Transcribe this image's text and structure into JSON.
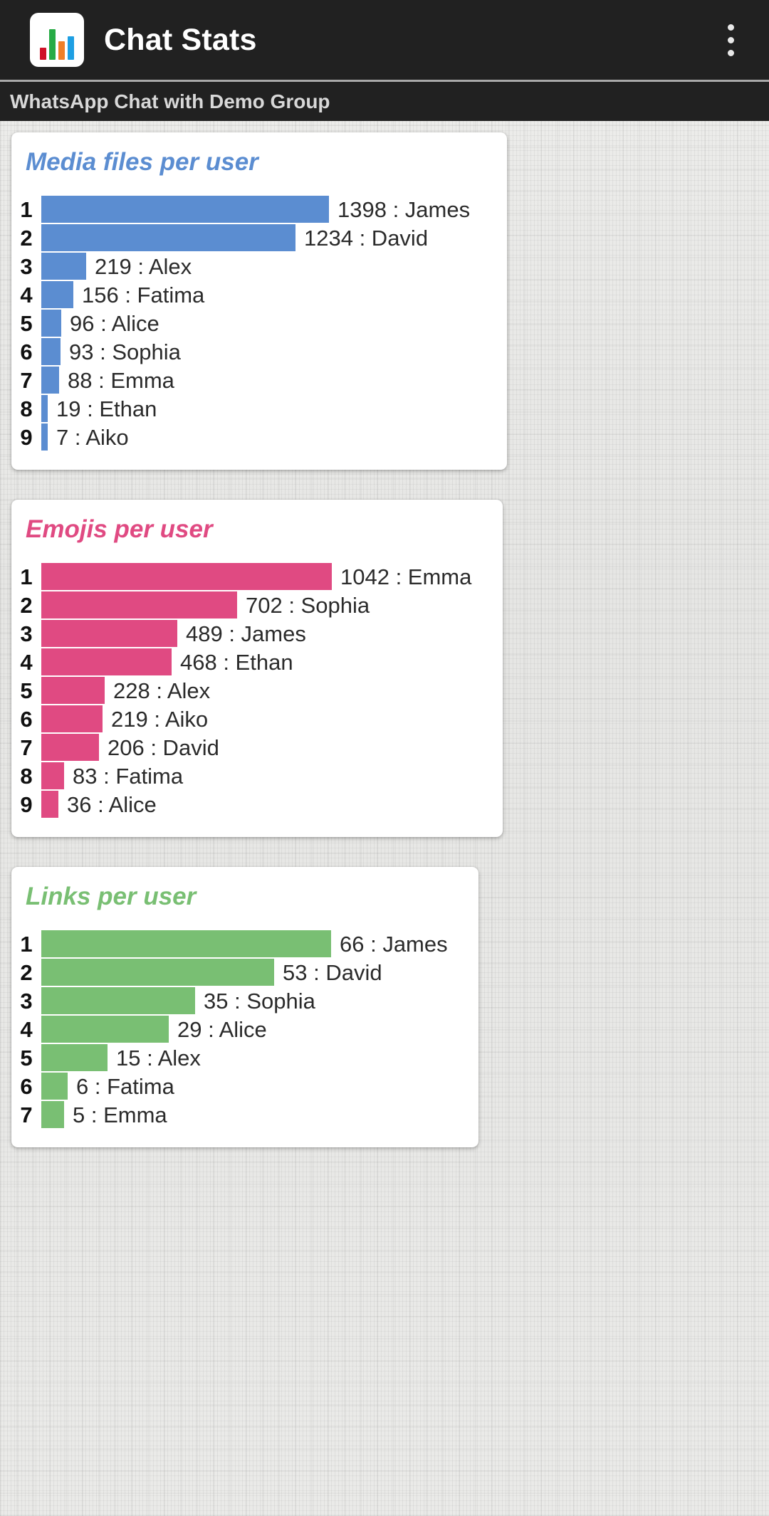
{
  "app": {
    "title": "Chat Stats",
    "icon_name": "bar-chart-app-icon",
    "icon_bar_colors": [
      "#cf1127",
      "#27ab45",
      "#f07f28",
      "#1e9fe3"
    ],
    "overflow_menu_label": "More options",
    "app_bar_color": "#212121",
    "subtitle": "WhatsApp Chat with Demo Group"
  },
  "chart_data": [
    {
      "type": "bar",
      "title": "Media files per user",
      "color": "#5b8dd1",
      "orientation": "horizontal",
      "xlabel": "",
      "ylabel": "",
      "max_value": 1398,
      "rows": [
        {
          "rank": "1",
          "value": 1398,
          "name": "James",
          "label": "1398 : James"
        },
        {
          "rank": "2",
          "value": 1234,
          "name": "David",
          "label": "1234 : David"
        },
        {
          "rank": "3",
          "value": 219,
          "name": "Alex",
          "label": "219 : Alex"
        },
        {
          "rank": "4",
          "value": 156,
          "name": "Fatima",
          "label": "156 : Fatima"
        },
        {
          "rank": "5",
          "value": 96,
          "name": "Alice",
          "label": "96 : Alice"
        },
        {
          "rank": "6",
          "value": 93,
          "name": "Sophia",
          "label": "93 : Sophia"
        },
        {
          "rank": "7",
          "value": 88,
          "name": "Emma",
          "label": "88 : Emma"
        },
        {
          "rank": "8",
          "value": 19,
          "name": "Ethan",
          "label": "19 : Ethan"
        },
        {
          "rank": "9",
          "value": 7,
          "name": "Aiko",
          "label": "7 : Aiko"
        }
      ]
    },
    {
      "type": "bar",
      "title": "Emojis per user",
      "color": "#e04a82",
      "orientation": "horizontal",
      "xlabel": "",
      "ylabel": "",
      "max_value": 1042,
      "rows": [
        {
          "rank": "1",
          "value": 1042,
          "name": "Emma",
          "label": "1042 : Emma"
        },
        {
          "rank": "2",
          "value": 702,
          "name": "Sophia",
          "label": "702 : Sophia"
        },
        {
          "rank": "3",
          "value": 489,
          "name": "James",
          "label": "489 : James"
        },
        {
          "rank": "4",
          "value": 468,
          "name": "Ethan",
          "label": "468 : Ethan"
        },
        {
          "rank": "5",
          "value": 228,
          "name": "Alex",
          "label": "228 : Alex"
        },
        {
          "rank": "6",
          "value": 219,
          "name": "Aiko",
          "label": "219 : Aiko"
        },
        {
          "rank": "7",
          "value": 206,
          "name": "David",
          "label": "206 : David"
        },
        {
          "rank": "8",
          "value": 83,
          "name": "Fatima",
          "label": "83 : Fatima"
        },
        {
          "rank": "9",
          "value": 36,
          "name": "Alice",
          "label": "36 : Alice"
        }
      ]
    },
    {
      "type": "bar",
      "title": "Links per user",
      "color": "#79bf73",
      "orientation": "horizontal",
      "xlabel": "",
      "ylabel": "",
      "max_value": 66,
      "rows": [
        {
          "rank": "1",
          "value": 66,
          "name": "James",
          "label": "66 : James"
        },
        {
          "rank": "2",
          "value": 53,
          "name": "David",
          "label": "53 : David"
        },
        {
          "rank": "3",
          "value": 35,
          "name": "Sophia",
          "label": "35 : Sophia"
        },
        {
          "rank": "4",
          "value": 29,
          "name": "Alice",
          "label": "29 : Alice"
        },
        {
          "rank": "5",
          "value": 15,
          "name": "Alex",
          "label": "15 : Alex"
        },
        {
          "rank": "6",
          "value": 6,
          "name": "Fatima",
          "label": "6 : Fatima"
        },
        {
          "rank": "7",
          "value": 5,
          "name": "Emma",
          "label": "5 : Emma"
        }
      ]
    }
  ]
}
